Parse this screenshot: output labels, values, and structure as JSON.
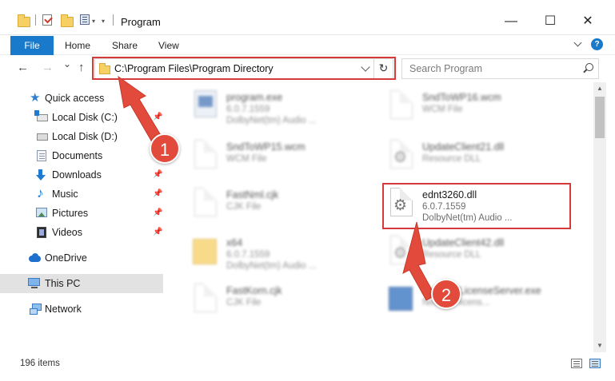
{
  "window": {
    "title": "Program",
    "minimize_glyph": "—",
    "maximize_glyph": "☐",
    "close_glyph": "✕"
  },
  "ribbon": {
    "tabs": [
      {
        "label": "File"
      },
      {
        "label": "Home"
      },
      {
        "label": "Share"
      },
      {
        "label": "View"
      }
    ],
    "help_glyph": "?"
  },
  "nav": {
    "back_glyph": "←",
    "forward_glyph": "→",
    "recent_glyph": "⌄",
    "up_glyph": "↑",
    "address_path": "C:\\Program Files\\Program Directory",
    "refresh_glyph": "↻",
    "search_placeholder": "Search Program"
  },
  "sidebar": {
    "items": [
      {
        "label": "Quick access",
        "icon": "star-icon"
      },
      {
        "label": "Local Disk (C:)",
        "icon": "disk-icon"
      },
      {
        "label": "Local Disk (D:)",
        "icon": "disk-icon"
      },
      {
        "label": "Documents",
        "icon": "documents-icon"
      },
      {
        "label": "Downloads",
        "icon": "downloads-icon"
      },
      {
        "label": "Music",
        "icon": "music-icon"
      },
      {
        "label": "Pictures",
        "icon": "pictures-icon"
      },
      {
        "label": "Videos",
        "icon": "videos-icon"
      },
      {
        "label": "OneDrive",
        "icon": "onedrive-icon"
      },
      {
        "label": "This PC",
        "icon": "pc-icon"
      },
      {
        "label": "Network",
        "icon": "network-icon"
      }
    ],
    "pin_glyph": "📌"
  },
  "files": [
    {
      "name": "program.exe",
      "line2": "6.0.7.1559",
      "line3": "DolbyNet(tm) Audio ..."
    },
    {
      "name": "SndToWP16.wcm",
      "line2": "WCM File",
      "line3": ""
    },
    {
      "name": "SndToWP15.wcm",
      "line2": "WCM File",
      "line3": ""
    },
    {
      "name": "UpdateClient21.dll",
      "line2": "Resource DLL",
      "line3": ""
    },
    {
      "name": "FastNml.cjk",
      "line2": "CJK File",
      "line3": ""
    },
    {
      "name": "ednt3260.dll",
      "line2": "6.0.7.1559",
      "line3": "DolbyNet(tm) Audio ..."
    },
    {
      "name": "x64",
      "line2": "6.0.7.1559",
      "line3": "DolbyNet(tm) Audio ..."
    },
    {
      "name": "UpdateClient42.dll",
      "line2": "Resource DLL",
      "line3": ""
    },
    {
      "name": "FastKorn.cjk",
      "line2": "CJK File",
      "line3": ""
    },
    {
      "name": "NetworkLicenseServer.exe",
      "line2": "Network licens...",
      "line3": ""
    }
  ],
  "annotations": {
    "step1": "1",
    "step2": "2",
    "color": "#e24a3b"
  },
  "status": {
    "item_count": "196 items"
  },
  "colors": {
    "accent": "#1979ca",
    "highlight_box": "#d63b3b"
  }
}
